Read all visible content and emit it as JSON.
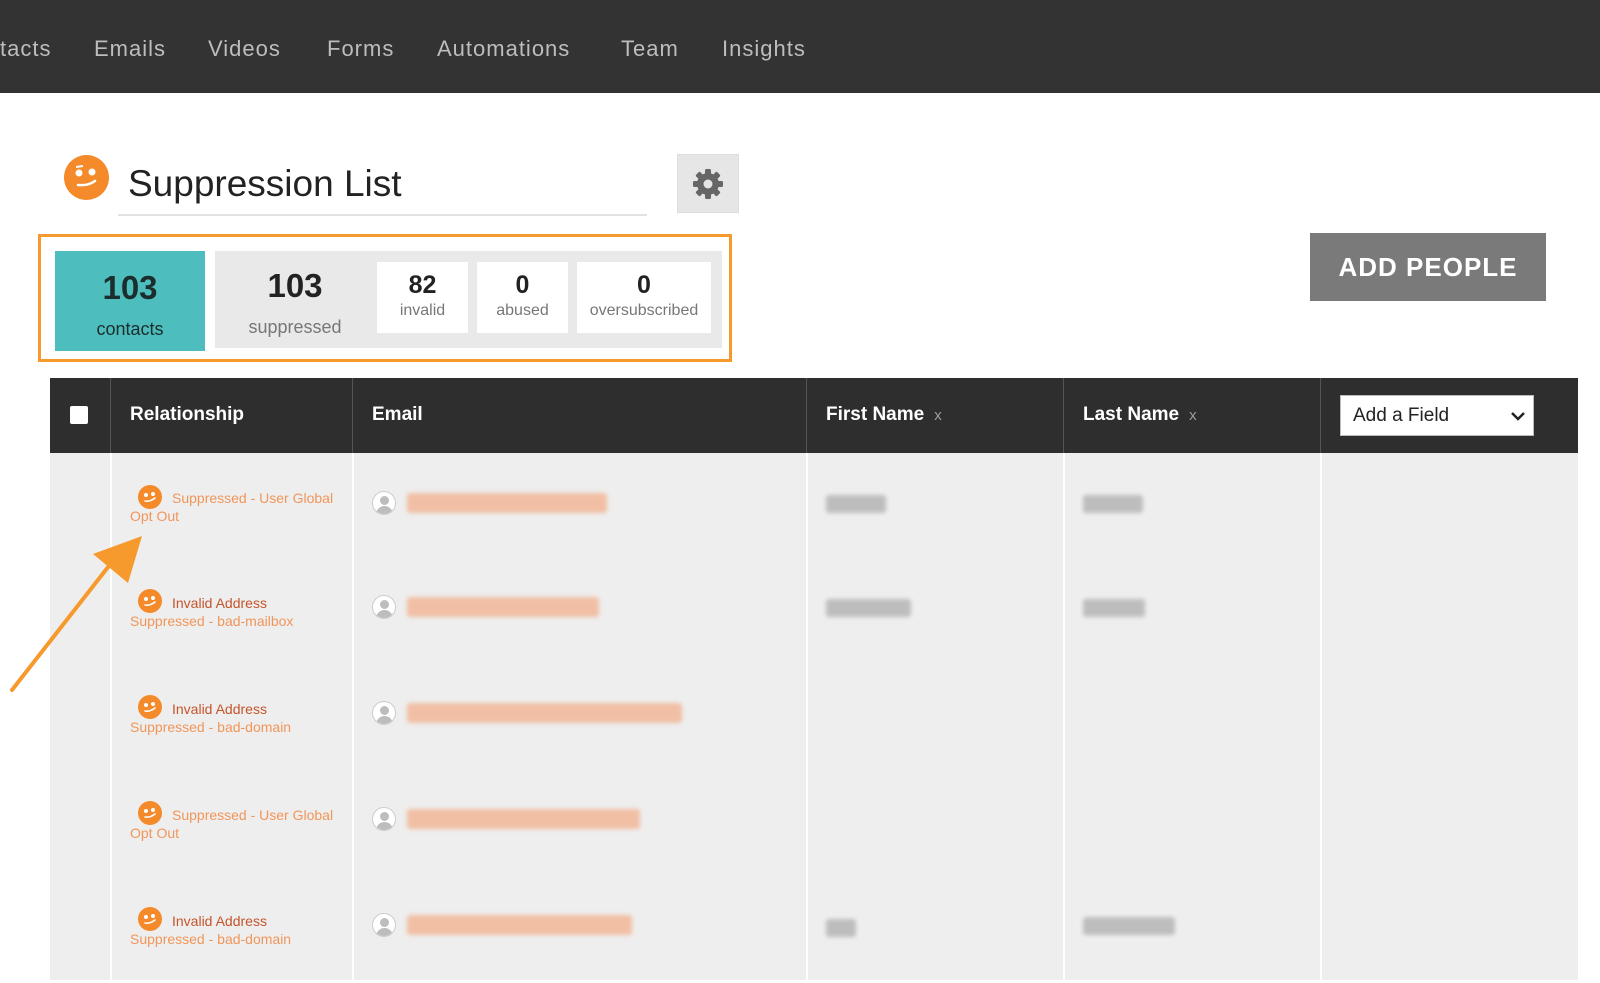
{
  "nav": {
    "items": [
      "tacts",
      "Emails",
      "Videos",
      "Forms",
      "Automations",
      "Team",
      "Insights"
    ]
  },
  "page": {
    "title": "Suppression List",
    "title_icon": "smiley-face-icon"
  },
  "settings_icon": "gear-icon",
  "stats": {
    "contacts": {
      "value": "103",
      "label": "contacts"
    },
    "suppressed": {
      "value": "103",
      "label": "suppressed"
    },
    "invalid": {
      "value": "82",
      "label": "invalid"
    },
    "abused": {
      "value": "0",
      "label": "abused"
    },
    "oversubscribed": {
      "value": "0",
      "label": "oversubscribed"
    }
  },
  "actions": {
    "add_people": "ADD PEOPLE"
  },
  "table": {
    "headers": {
      "relationship": "Relationship",
      "email": "Email",
      "first_name": "First Name",
      "last_name": "Last Name",
      "remove": "x",
      "add_field": "Add a Field"
    },
    "rows": [
      {
        "status_line1": "Suppressed - User Global",
        "status_line2": "Opt Out",
        "email": "[blurred]",
        "first_name": "[blurred]",
        "last_name": "[blurred]"
      },
      {
        "status_line1": "Invalid Address",
        "status_line2": "Suppressed - bad-mailbox",
        "email": "[blurred]",
        "first_name": "[blurred]",
        "last_name": "[blurred]"
      },
      {
        "status_line1": "Invalid Address",
        "status_line2": "Suppressed - bad-domain",
        "email": "[blurred]",
        "first_name": "",
        "last_name": ""
      },
      {
        "status_line1": "Suppressed - User Global",
        "status_line2": "Opt Out",
        "email": "[blurred]",
        "first_name": "",
        "last_name": ""
      },
      {
        "status_line1": "Invalid Address",
        "status_line2": "Suppressed - bad-domain",
        "email": "[blurred]",
        "first_name": "[blurred]",
        "last_name": "[blurred]"
      }
    ]
  },
  "colors": {
    "nav_bg": "#333333",
    "accent_orange": "#f58a2b",
    "highlight_frame": "#f79a2e",
    "contacts_teal": "#4dbdbd",
    "invalid_red": "#c5542b",
    "table_header": "#2e2e2e",
    "button_grey": "#7a7a7a"
  }
}
